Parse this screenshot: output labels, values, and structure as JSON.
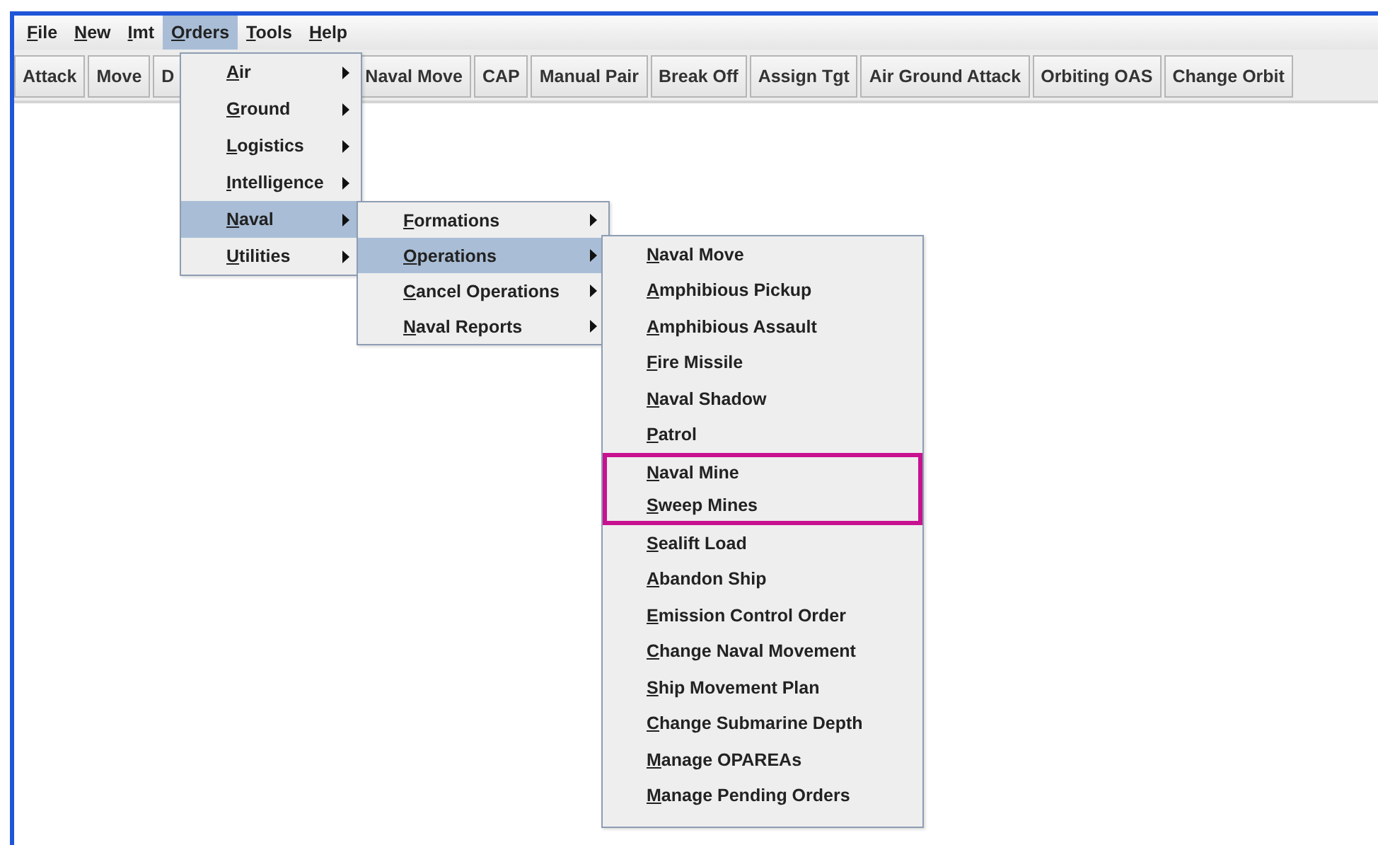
{
  "menubar": [
    {
      "label": "File",
      "selected": false
    },
    {
      "label": "New",
      "selected": false
    },
    {
      "label": "Imt",
      "selected": false
    },
    {
      "label": "Orders",
      "selected": true
    },
    {
      "label": "Tools",
      "selected": false
    },
    {
      "label": "Help",
      "selected": false
    }
  ],
  "toolbar": [
    "Attack",
    "Move",
    "D",
    "Naval Move",
    "CAP",
    "Manual Pair",
    "Break Off",
    "Assign Tgt",
    "Air Ground Attack",
    "Orbiting OAS",
    "Change Orbit"
  ],
  "orders_menu": [
    {
      "label": "Air",
      "selected": false
    },
    {
      "label": "Ground",
      "selected": false
    },
    {
      "label": "Logistics",
      "selected": false
    },
    {
      "label": "Intelligence",
      "selected": false
    },
    {
      "label": "Naval",
      "selected": true
    },
    {
      "label": "Utilities",
      "selected": false
    }
  ],
  "naval_menu": [
    {
      "label": "Formations",
      "selected": false
    },
    {
      "label": "Operations",
      "selected": true
    },
    {
      "label": "Cancel Operations",
      "selected": false
    },
    {
      "label": "Naval Reports",
      "selected": false
    }
  ],
  "operations_menu": [
    {
      "label": "Naval Move",
      "highlighted": false
    },
    {
      "label": "Amphibious Pickup",
      "highlighted": false
    },
    {
      "label": "Amphibious Assault",
      "highlighted": false
    },
    {
      "label": "Fire Missile",
      "highlighted": false
    },
    {
      "label": "Naval Shadow",
      "highlighted": false
    },
    {
      "label": "Patrol",
      "highlighted": false
    },
    {
      "label": "Naval Mine",
      "highlighted": true
    },
    {
      "label": "Sweep Mines",
      "highlighted": true
    },
    {
      "label": "Sealift Load",
      "highlighted": false
    },
    {
      "label": "Abandon Ship",
      "highlighted": false
    },
    {
      "label": "Emission Control Order",
      "highlighted": false
    },
    {
      "label": "Change Naval Movement",
      "highlighted": false
    },
    {
      "label": "Ship Movement Plan",
      "highlighted": false
    },
    {
      "label": "Change Submarine Depth",
      "highlighted": false
    },
    {
      "label": "Manage OPAREAs",
      "highlighted": false
    },
    {
      "label": "Manage Pending Orders",
      "highlighted": false
    }
  ]
}
